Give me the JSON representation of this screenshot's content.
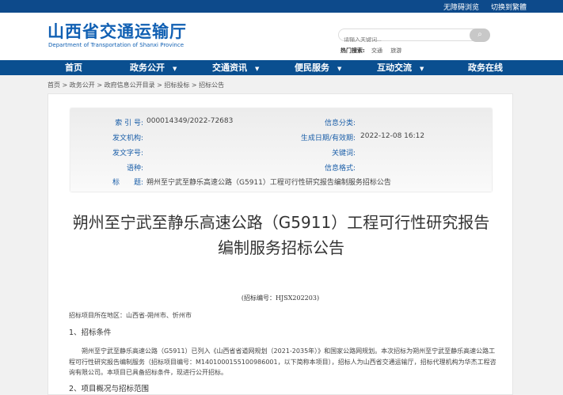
{
  "topbar": {
    "accessible": "无障碍浏览",
    "switch": "切换到繁體"
  },
  "header": {
    "logo_cn": "山西省交通运输厅",
    "logo_en": "Department of Transportation of Shanxi Province",
    "search_placeholder": "请输入关键词...",
    "hot_label": "热门搜索:",
    "hot": [
      "交通",
      "旅游"
    ]
  },
  "nav": [
    {
      "label": "首页"
    },
    {
      "label": "政务公开",
      "arrow": "▼"
    },
    {
      "label": "交通资讯",
      "arrow": "▼"
    },
    {
      "label": "便民服务",
      "arrow": "▼"
    },
    {
      "label": "互动交流",
      "arrow": "▼"
    },
    {
      "label": "政务在线"
    }
  ],
  "breadcrumb": "首页 > 政务公开 > 政府信息公开目录 > 招标投标 > 招标公告",
  "meta": {
    "index_label": "索 引 号:",
    "index": "000014349/2022-72683",
    "category_label": "信息分类:",
    "org_label": "发文机构:",
    "date_label": "生成日期/有效期:",
    "date": "2022-12-08 16:12",
    "docno_label": "发文字号:",
    "keywords_label": "关键词:",
    "lang_label": "语种:",
    "format_label": "信息格式:",
    "title_label": "标　　题:",
    "title": "朔州至宁武至静乐高速公路（G5911）工程可行性研究报告编制服务招标公告"
  },
  "article": {
    "title": "朔州至宁武至静乐高速公路（G5911）工程可行性研究报告编制服务招标公告",
    "code": "(招标编号：HJSX202203)",
    "location": "招标项目所在地区：山西省-朔州市、忻州市",
    "s1": "1、招标条件",
    "p1": "朔州至宁武至静乐高速公路（G5911）已列入《山西省省道网规划（2021-2035年）》和国家公路网规划。本次招标为朔州至宁武至静乐高速公路工程可行性研究报告编制服务（招标项目编号：M1401000155100986001，以下简称本项目），招标人为山西省交通运输厅，招标代理机构为华杰工程咨询有限公司。本项目已具备招标条件，现进行公开招标。",
    "s2": "2、项目概况与招标范围"
  }
}
